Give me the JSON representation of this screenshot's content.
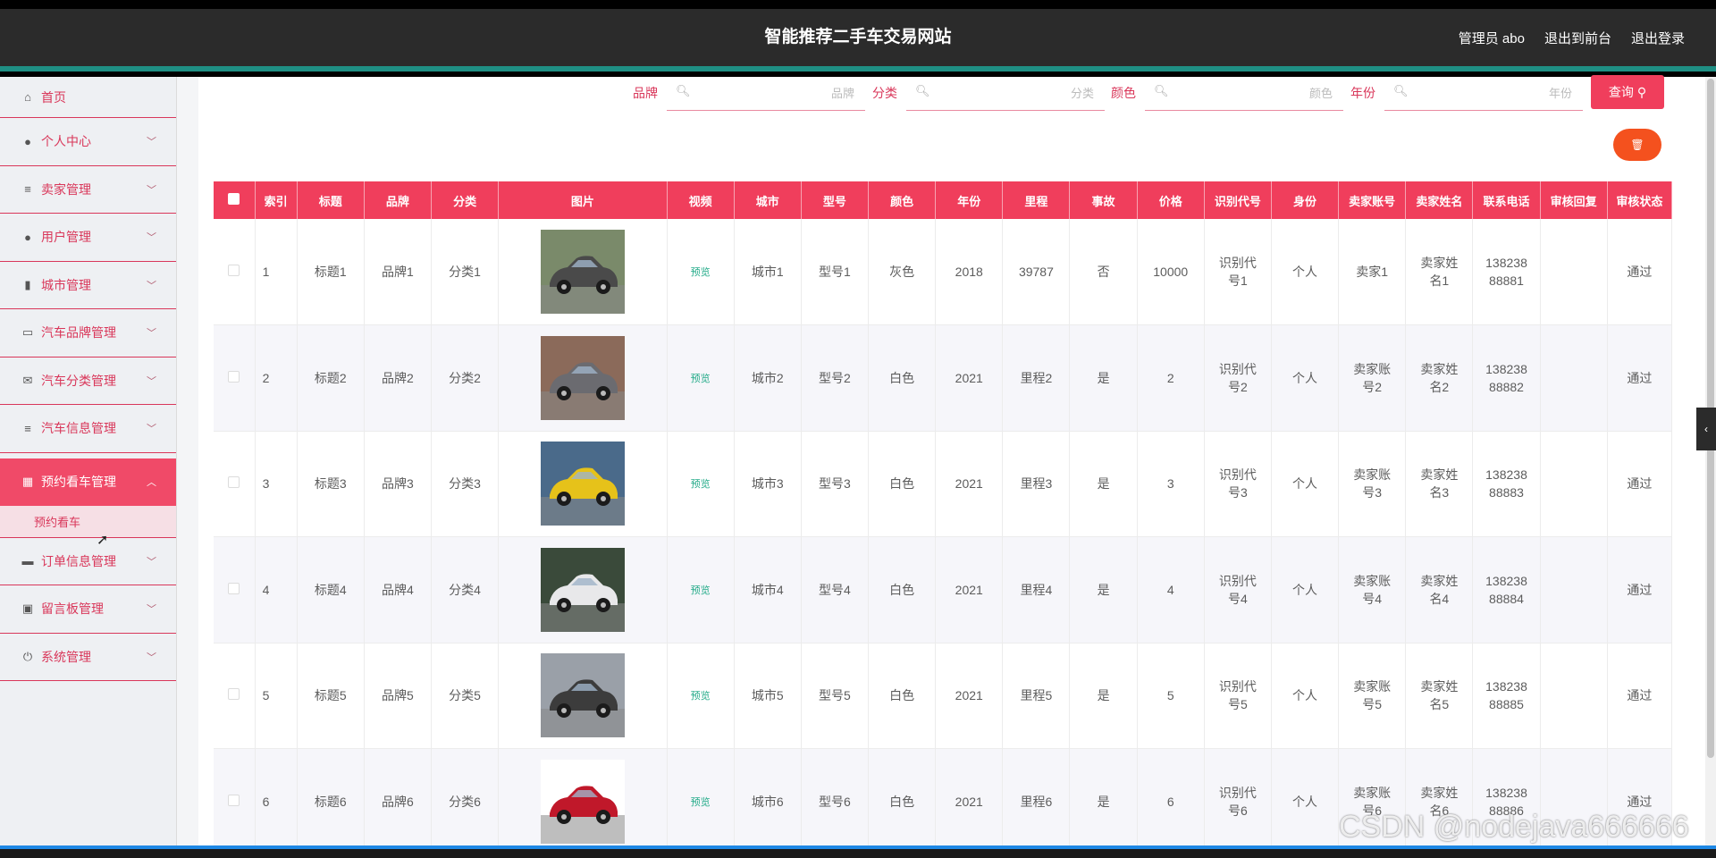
{
  "header": {
    "title": "智能推荐二手车交易网站",
    "admin_label": "管理员 abo",
    "back_to_front": "退出到前台",
    "logout": "退出登录"
  },
  "sidebar": {
    "items": [
      {
        "label": "首页",
        "icon": "home-icon"
      },
      {
        "label": "个人中心",
        "icon": "user-icon"
      },
      {
        "label": "卖家管理",
        "icon": "list-icon"
      },
      {
        "label": "用户管理",
        "icon": "user-icon"
      },
      {
        "label": "城市管理",
        "icon": "bar-chart-icon"
      },
      {
        "label": "汽车品牌管理",
        "icon": "ticket-icon"
      },
      {
        "label": "汽车分类管理",
        "icon": "mail-icon"
      },
      {
        "label": "汽车信息管理",
        "icon": "list-icon"
      },
      {
        "label": "预约看车管理",
        "icon": "calendar-icon"
      },
      {
        "label": "订单信息管理",
        "icon": "printer-icon"
      },
      {
        "label": "留言板管理",
        "icon": "clipboard-icon"
      },
      {
        "label": "系统管理",
        "icon": "power-icon"
      }
    ],
    "active_sub": "预约看车"
  },
  "search": {
    "brand_label": "品牌",
    "brand_placeholder": "品牌",
    "category_label": "分类",
    "category_placeholder": "分类",
    "color_label": "颜色",
    "color_placeholder": "颜色",
    "year_label": "年份",
    "year_placeholder": "年份",
    "query_button": "查询"
  },
  "table": {
    "columns": [
      "索引",
      "标题",
      "品牌",
      "分类",
      "图片",
      "视频",
      "城市",
      "型号",
      "颜色",
      "年份",
      "里程",
      "事故",
      "价格",
      "识别代号",
      "身份",
      "卖家账号",
      "卖家姓名",
      "联系电话",
      "审核回复",
      "审核状态"
    ],
    "preview_label": "预览",
    "rows": [
      {
        "index": "1",
        "title": "标题1",
        "brand": "品牌1",
        "category": "分类1",
        "city": "城市1",
        "model": "型号1",
        "color": "灰色",
        "year": "2018",
        "mileage": "39787",
        "accident": "否",
        "price": "10000",
        "vin": "识别代号1",
        "identity": "个人",
        "seller_account": "卖家1",
        "seller_name": "卖家姓名1",
        "phone": "13823888881",
        "reply": "",
        "status": "通过"
      },
      {
        "index": "2",
        "title": "标题2",
        "brand": "品牌2",
        "category": "分类2",
        "city": "城市2",
        "model": "型号2",
        "color": "白色",
        "year": "2021",
        "mileage": "里程2",
        "accident": "是",
        "price": "2",
        "vin": "识别代号2",
        "identity": "个人",
        "seller_account": "卖家账号2",
        "seller_name": "卖家姓名2",
        "phone": "13823888882",
        "reply": "",
        "status": "通过"
      },
      {
        "index": "3",
        "title": "标题3",
        "brand": "品牌3",
        "category": "分类3",
        "city": "城市3",
        "model": "型号3",
        "color": "白色",
        "year": "2021",
        "mileage": "里程3",
        "accident": "是",
        "price": "3",
        "vin": "识别代号3",
        "identity": "个人",
        "seller_account": "卖家账号3",
        "seller_name": "卖家姓名3",
        "phone": "13823888883",
        "reply": "",
        "status": "通过"
      },
      {
        "index": "4",
        "title": "标题4",
        "brand": "品牌4",
        "category": "分类4",
        "city": "城市4",
        "model": "型号4",
        "color": "白色",
        "year": "2021",
        "mileage": "里程4",
        "accident": "是",
        "price": "4",
        "vin": "识别代号4",
        "identity": "个人",
        "seller_account": "卖家账号4",
        "seller_name": "卖家姓名4",
        "phone": "13823888884",
        "reply": "",
        "status": "通过"
      },
      {
        "index": "5",
        "title": "标题5",
        "brand": "品牌5",
        "category": "分类5",
        "city": "城市5",
        "model": "型号5",
        "color": "白色",
        "year": "2021",
        "mileage": "里程5",
        "accident": "是",
        "price": "5",
        "vin": "识别代号5",
        "identity": "个人",
        "seller_account": "卖家账号5",
        "seller_name": "卖家姓名5",
        "phone": "13823888885",
        "reply": "",
        "status": "通过"
      },
      {
        "index": "6",
        "title": "标题6",
        "brand": "品牌6",
        "category": "分类6",
        "city": "城市6",
        "model": "型号6",
        "color": "白色",
        "year": "2021",
        "mileage": "里程6",
        "accident": "是",
        "price": "6",
        "vin": "识别代号6",
        "identity": "个人",
        "seller_account": "卖家账号6",
        "seller_name": "卖家姓名6",
        "phone": "13823888886",
        "reply": "",
        "status": "通过"
      }
    ]
  },
  "watermark": "CSDN @nodejava666666"
}
